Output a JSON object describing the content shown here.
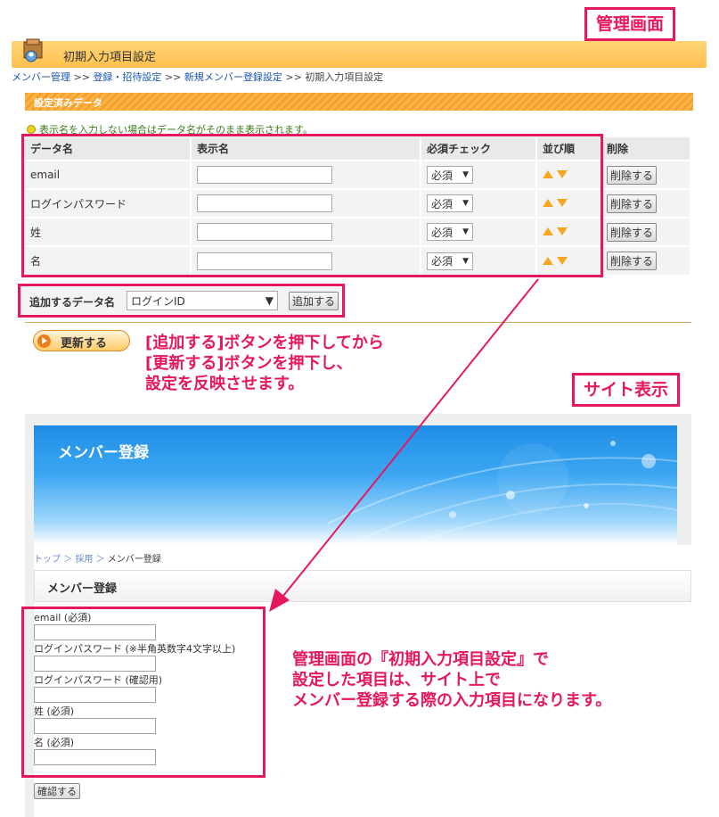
{
  "callouts": {
    "admin_label": "管理画面",
    "site_label": "サイト表示",
    "update_note": [
      "[追加する]ボタンを押下してから",
      "[更新する]ボタンを押下し、",
      "設定を反映させます。"
    ],
    "site_note": [
      "管理画面の『初期入力項目設定』で",
      "設定した項目は、サイト上で",
      "メンバー登録する際の入力項目になります。"
    ]
  },
  "admin": {
    "page_title": "初期入力項目設定",
    "breadcrumb": [
      {
        "label": "メンバー管理",
        "link": true
      },
      {
        "label": ">>",
        "link": false
      },
      {
        "label": "登録・招待設定",
        "link": true
      },
      {
        "label": ">>",
        "link": false
      },
      {
        "label": "新規メンバー登録設定",
        "link": true
      },
      {
        "label": ">>",
        "link": false
      },
      {
        "label": "初期入力項目設定",
        "link": false
      }
    ],
    "section_title": "設定済みデータ",
    "hint": "表示名を入力しない場合はデータ名がそのまま表示されます。",
    "table": {
      "headers": [
        "データ名",
        "表示名",
        "必須チェック",
        "並び順",
        "削除"
      ],
      "rows": [
        {
          "data_name": "email",
          "display_name": "",
          "required": "必須",
          "delete": "削除する"
        },
        {
          "data_name": "ログインパスワード",
          "display_name": "",
          "required": "必須",
          "delete": "削除する"
        },
        {
          "data_name": "姓",
          "display_name": "",
          "required": "必須",
          "delete": "削除する"
        },
        {
          "data_name": "名",
          "display_name": "",
          "required": "必須",
          "delete": "削除する"
        }
      ]
    },
    "add_row": {
      "label": "追加するデータ名",
      "selected": "ログインID",
      "button": "追加する"
    },
    "update_button": "更新する"
  },
  "site": {
    "hero_title": "メンバー登録",
    "breadcrumb": [
      "トップ",
      "採用",
      "メンバー登録"
    ],
    "page_title": "メンバー登録",
    "fields": [
      {
        "label": "email (必須)"
      },
      {
        "label": "ログインパスワード (※半角英数字4文字以上)"
      },
      {
        "label": "ログインパスワード (確認用)"
      },
      {
        "label": "姓 (必須)"
      },
      {
        "label": "名 (必須)"
      }
    ],
    "confirm_button": "確認する"
  },
  "colors": {
    "accent": "#e5185e",
    "header": "#ffc04a",
    "stripe": "#f7a02c"
  }
}
